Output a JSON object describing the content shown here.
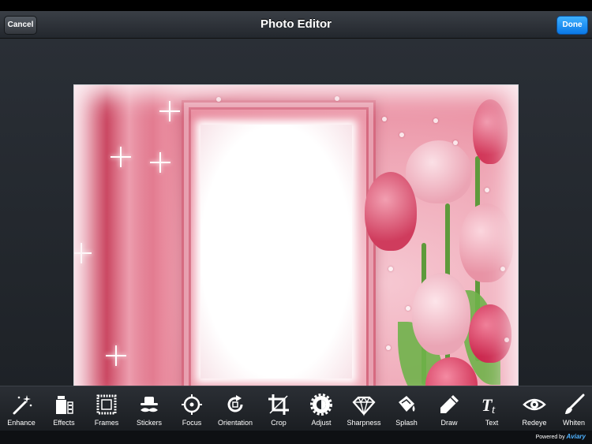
{
  "navbar": {
    "title": "Photo Editor",
    "cancel_label": "Cancel",
    "done_label": "Done"
  },
  "tools": [
    {
      "label": "Enhance",
      "icon": "magic-wand-icon"
    },
    {
      "label": "Effects",
      "icon": "effects-icon"
    },
    {
      "label": "Frames",
      "icon": "frame-icon"
    },
    {
      "label": "Stickers",
      "icon": "mustache-hat-icon"
    },
    {
      "label": "Focus",
      "icon": "crosshair-icon"
    },
    {
      "label": "Orientation",
      "icon": "rotate-icon"
    },
    {
      "label": "Crop",
      "icon": "crop-icon"
    },
    {
      "label": "Adjust",
      "icon": "gear-adjust-icon"
    },
    {
      "label": "Sharpness",
      "icon": "diamond-icon"
    },
    {
      "label": "Splash",
      "icon": "paint-bucket-icon"
    },
    {
      "label": "Draw",
      "icon": "pencil-icon"
    },
    {
      "label": "Text",
      "icon": "text-icon"
    },
    {
      "label": "Redeye",
      "icon": "eye-icon"
    },
    {
      "label": "Whiten",
      "icon": "brush-icon"
    }
  ],
  "footer": {
    "powered_label": "Powered by",
    "brand": "Aviary"
  },
  "colors": {
    "done_button": "#1b8ff2",
    "toolbar_bg": "#22262b",
    "photo_pink": "#e98a9d"
  }
}
